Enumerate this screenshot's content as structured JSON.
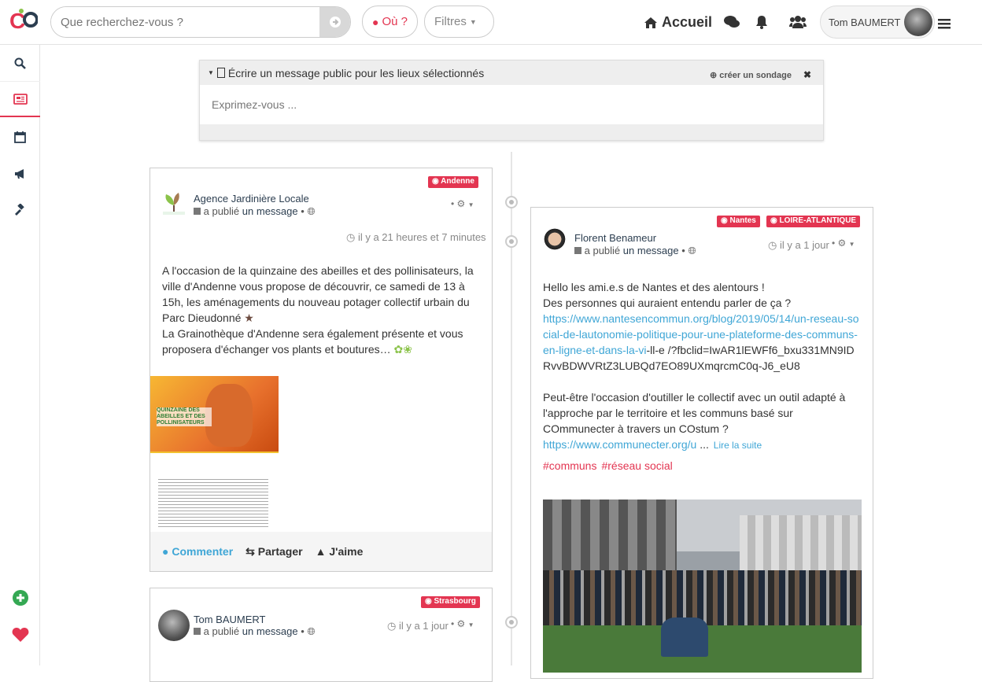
{
  "header": {
    "search_placeholder": "Que recherchez-vous ?",
    "where_label": "Où ?",
    "filters_label": "Filtres",
    "home_label": "Accueil",
    "user_name": "Tom BAUMERT"
  },
  "composer": {
    "title": "Écrire un message public pour les lieux sélectionnés",
    "poll_label": "créer un sondage",
    "placeholder": "Exprimez-vous ..."
  },
  "posts": [
    {
      "tags": [
        "Andenne"
      ],
      "author": "Agence Jardinière Locale",
      "published": "a publié",
      "object": "un message",
      "time": "il y a 21 heures et 7 minutes",
      "text": "A l'occasion de la quinzaine des abeilles et des pollinisateurs, la ville d'Andenne vous propose de découvrir, ce samedi de 13 à 15h, les aménagements du nouveau potager collectif urbain du Parc Dieudonné",
      "text2": "La Grainothèque d'Andenne sera également présente et vous proposera d'échanger vos plants et boutures…",
      "poster_title": "QUINZAINE DES ABEILLES ET DES POLLINISATEURS",
      "actions": {
        "comment": "Commenter",
        "share": "Partager",
        "like": "J'aime"
      }
    },
    {
      "tags": [
        "Nantes",
        "LOIRE-ATLANTIQUE"
      ],
      "author": "Florent Benameur",
      "published": "a publié",
      "object": "un message",
      "time": "il y a 1 jour",
      "line1": "Hello les ami.e.s de Nantes et des alentours !",
      "line2": "Des personnes qui auraient entendu parler de ça ?",
      "link1": "https://www.nantesencommun.org/blog/2019/05/14/un-reseau-social-de-lautonomie-politique-pour-une-plateforme-des-communs-en-ligne-et-dans-la-vi",
      "link1_tail": "-ll-e /?fbclid=IwAR1lEWFf6_bxu331MN9IDRvvBDWVRtZ3LUBQd7EO89UXmqrcmC0q-J6_eU8",
      "line3": "Peut-être l'occasion d'outiller le collectif avec un outil adapté à l'approche par le territoire et les communs basé sur COmmunecter à travers un COstum ?",
      "link2": "https://www.communecter.org/u",
      "ellipsis": "...",
      "read_more": "Lire la suite",
      "hashtags": [
        "#communs",
        "#réseau social"
      ]
    },
    {
      "tags": [
        "Strasbourg"
      ],
      "author": "Tom BAUMERT",
      "published": "a publié",
      "object": "un message",
      "time": "il y a 1 jour"
    }
  ],
  "colors": {
    "accent": "#e33551",
    "link": "#3fa6d6",
    "dark": "#2c3e50"
  }
}
